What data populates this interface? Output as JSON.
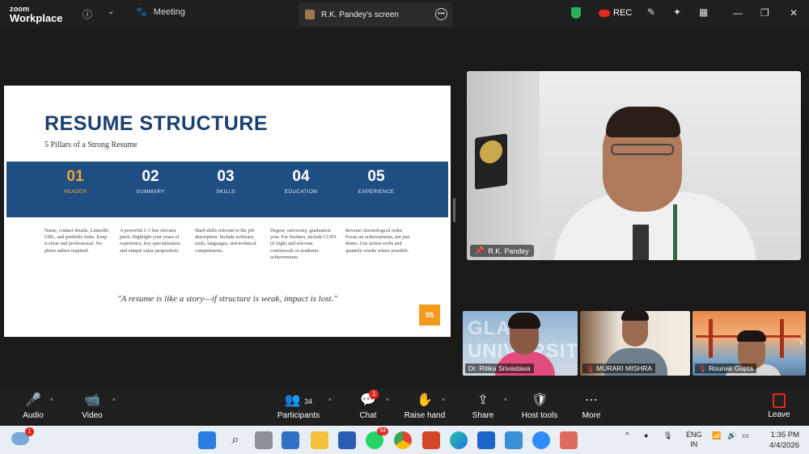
{
  "app": {
    "logo_top": "zoom",
    "logo_bottom": "Workplace"
  },
  "tabs": {
    "meeting": "Meeting",
    "screen_share": "R.K. Pandey's screen"
  },
  "topbar": {
    "rec_label": "REC"
  },
  "slide": {
    "title": "RESUME STRUCTURE",
    "subtitle": "5 Pillars of a Strong Resume",
    "pillars": [
      {
        "num": "01",
        "label": "HEADER",
        "desc": "Name, contact details, LinkedIn URL, and portfolio links. Keep it clean and professional. No photo unless required."
      },
      {
        "num": "02",
        "label": "SUMMARY",
        "desc": "A powerful 2-3 line elevator pitch. Highlight your years of experience, key specialization, and unique value proposition."
      },
      {
        "num": "03",
        "label": "SKILLS",
        "desc": "Hard skills relevant to the job description. Include software, tools, languages, and technical competencies."
      },
      {
        "num": "04",
        "label": "EDUCATION",
        "desc": "Degree, university, graduation year. For freshers, include CGPA (if high) and relevant coursework or academic achievements."
      },
      {
        "num": "05",
        "label": "EXPERIENCE",
        "desc": "Reverse chronological order. Focus on achievements, not just duties. Use action verbs and quantify results where possible."
      }
    ],
    "quote": "\"A resume is like a story—if structure is weak, impact is lost.\"",
    "page_number": "05"
  },
  "speaker": {
    "name": "R.K. Pandey"
  },
  "gallery": {
    "participants": [
      {
        "name": "Dr. Ritika Srivastava",
        "bg_text": "GLA UNIVERSITY"
      },
      {
        "name": "MURARI MISHRA"
      },
      {
        "name": "Rounak Gupta"
      }
    ]
  },
  "controls": {
    "audio": "Audio",
    "video": "Video",
    "participants": "Participants",
    "participants_count": "34",
    "chat": "Chat",
    "chat_badge": "1",
    "raise_hand": "Raise hand",
    "share": "Share",
    "host_tools": "Host tools",
    "more": "More",
    "leave": "Leave"
  },
  "taskbar": {
    "weather_badge": "1",
    "whatsapp_badge": "54",
    "lang_1": "ENG",
    "lang_2": "IN",
    "time": "1:35 PM",
    "date": "4/4/2026"
  },
  "colors": {
    "slide_band": "#1f4e82",
    "slide_title": "#1b3f6e",
    "accent_orange": "#f2a535",
    "leave_red": "#e0281f",
    "shield_green": "#23b45a"
  }
}
